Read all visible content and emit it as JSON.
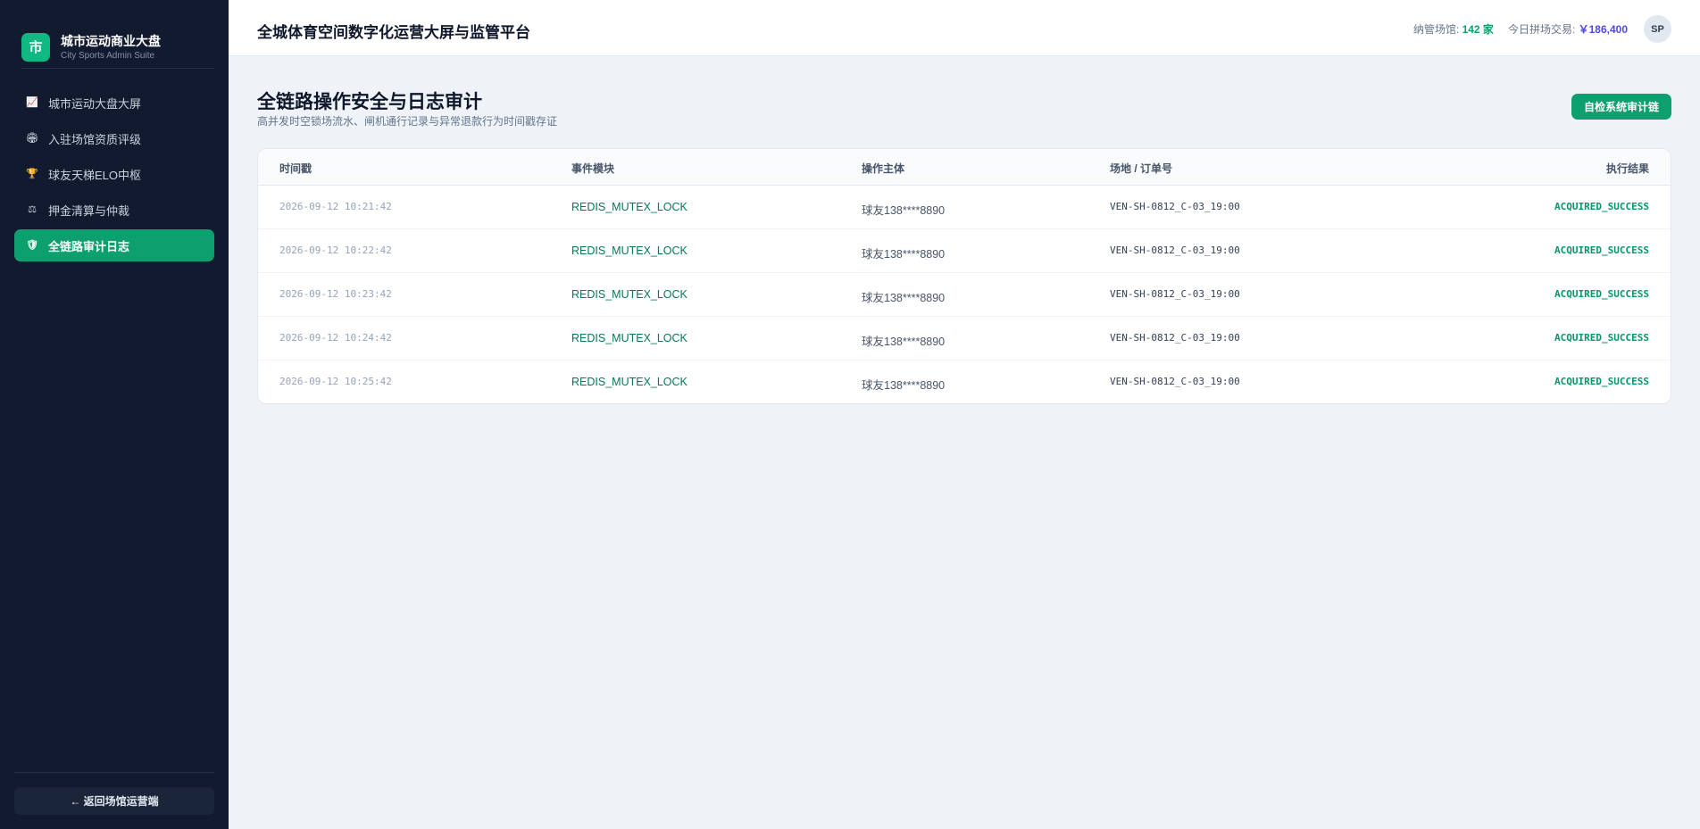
{
  "brand": {
    "logo_char": "市",
    "title": "城市运动商业大盘",
    "subtitle": "City Sports Admin Suite"
  },
  "sidebar": {
    "items": [
      {
        "icon": "chart-icon",
        "glyph": "📈",
        "label": "城市运动大盘大屏"
      },
      {
        "icon": "stadium-icon",
        "glyph": "🏟",
        "label": "入驻场馆资质评级"
      },
      {
        "icon": "trophy-icon",
        "glyph": "🏆",
        "label": "球友天梯ELO中枢"
      },
      {
        "icon": "scale-icon",
        "glyph": "⚖",
        "label": "押金清算与仲裁"
      },
      {
        "icon": "shield-icon",
        "glyph": "🛡",
        "label": "全链路审计日志",
        "active": true
      }
    ],
    "back_label": "← 返回场馆运营端"
  },
  "header": {
    "title": "全城体育空间数字化运营大屏与监管平台",
    "venues_label": "纳管场馆: ",
    "venues_value": "142 家",
    "trade_label": "今日拼场交易: ",
    "trade_value": "￥186,400",
    "avatar": "SP"
  },
  "main": {
    "title": "全链路操作安全与日志审计",
    "subtitle": "高并发时空锁场流水、闸机通行记录与异常退款行为时间戳存证",
    "audit_button": "自检系统审计链"
  },
  "table": {
    "columns": [
      "时间戳",
      "事件模块",
      "操作主体",
      "场地 / 订单号",
      "执行结果"
    ],
    "rows": [
      {
        "time": "2026-09-12 10:21:42",
        "module": "REDIS_MUTEX_LOCK",
        "actor": "球友138****8890",
        "order": "VEN-SH-0812_C-03_19:00",
        "result": "ACQUIRED_SUCCESS"
      },
      {
        "time": "2026-09-12 10:22:42",
        "module": "REDIS_MUTEX_LOCK",
        "actor": "球友138****8890",
        "order": "VEN-SH-0812_C-03_19:00",
        "result": "ACQUIRED_SUCCESS"
      },
      {
        "time": "2026-09-12 10:23:42",
        "module": "REDIS_MUTEX_LOCK",
        "actor": "球友138****8890",
        "order": "VEN-SH-0812_C-03_19:00",
        "result": "ACQUIRED_SUCCESS"
      },
      {
        "time": "2026-09-12 10:24:42",
        "module": "REDIS_MUTEX_LOCK",
        "actor": "球友138****8890",
        "order": "VEN-SH-0812_C-03_19:00",
        "result": "ACQUIRED_SUCCESS"
      },
      {
        "time": "2026-09-12 10:25:42",
        "module": "REDIS_MUTEX_LOCK",
        "actor": "球友138****8890",
        "order": "VEN-SH-0812_C-03_19:00",
        "result": "ACQUIRED_SUCCESS"
      }
    ]
  },
  "colors": {
    "accent": "#0e9f6e",
    "sidebar_bg": "#111a2e",
    "page_bg": "#eff3f8"
  }
}
